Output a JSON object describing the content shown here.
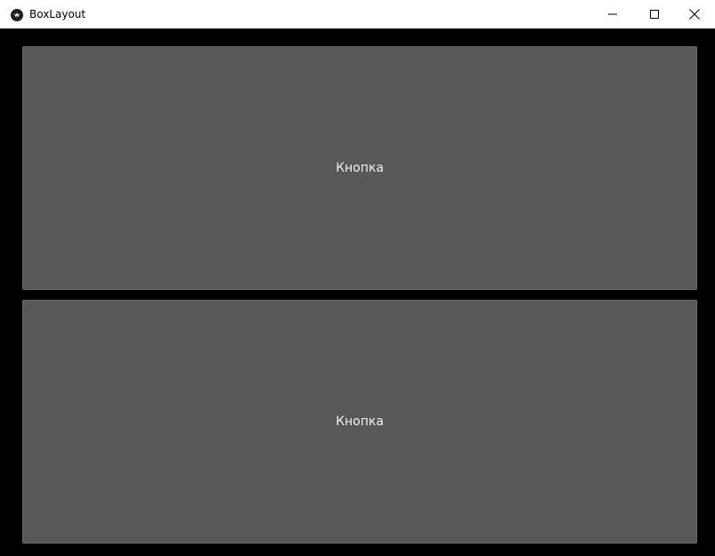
{
  "window": {
    "title": "BoxLayout",
    "icon": "kivy-logo-icon",
    "controls": {
      "minimize": "minimize-icon",
      "maximize": "maximize-icon",
      "close": "close-icon"
    }
  },
  "buttons": [
    {
      "label": "Кнопка"
    },
    {
      "label": "Кнопка"
    }
  ],
  "colors": {
    "button_bg": "#585858",
    "background": "#000000",
    "titlebar": "#ffffff",
    "label": "#f2f2f2"
  }
}
